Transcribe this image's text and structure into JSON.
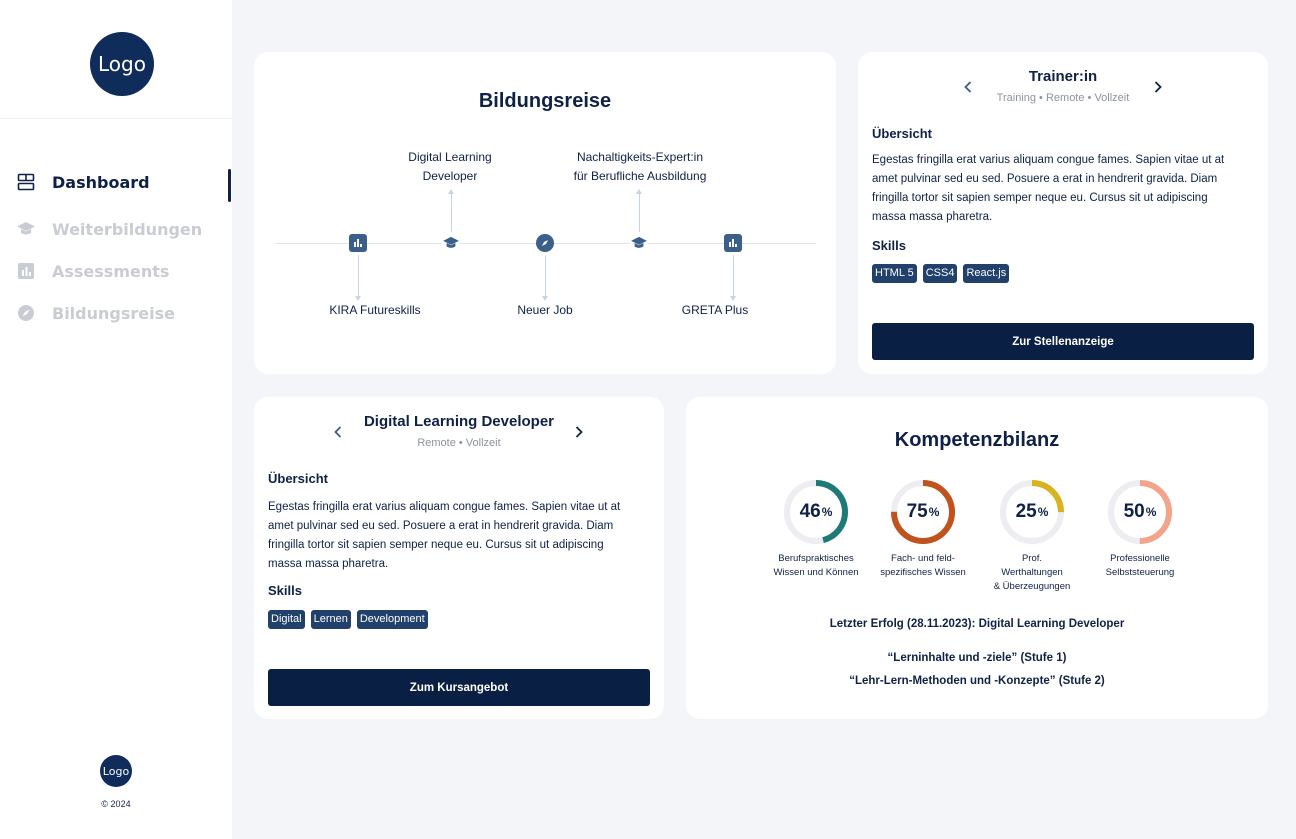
{
  "sidebar": {
    "logo": "Logo",
    "nav": [
      {
        "label": "Dashboard",
        "icon": "dashboard-icon",
        "active": true
      },
      {
        "label": "Weiterbildungen",
        "icon": "graduation-cap-icon",
        "active": false
      },
      {
        "label": "Assessments",
        "icon": "bar-chart-icon",
        "active": false
      },
      {
        "label": "Bildungsreise",
        "icon": "compass-icon",
        "active": false
      }
    ],
    "footer_logo": "Logo",
    "copyright": "© 2024"
  },
  "journey": {
    "title": "Bildungsreise",
    "above": [
      {
        "line1": "Digital Learning",
        "line2": "Developer"
      },
      {
        "line1": "Nachaltigkeits-Expert:in",
        "line2": "für Berufliche Ausbildung"
      }
    ],
    "below": [
      "KIRA Futureskills",
      "Neuer Job",
      "GRETA Plus"
    ],
    "nodes": [
      "bar-chart-icon",
      "graduation-cap-icon",
      "compass-icon",
      "graduation-cap-icon",
      "bar-chart-icon"
    ]
  },
  "job": {
    "title": "Trainer:in",
    "subtitle": "Training • Remote • Vollzeit",
    "overview_heading": "Übersicht",
    "overview_text": "Egestas fringilla erat varius aliquam congue fames. Sapien vitae ut at amet pulvinar sed eu sed. Posuere a erat in hendrerit gravida. Diam fringilla tortor sit sapien semper neque eu. Cursus sit ut adipiscing massa massa pharetra.",
    "skills_heading": "Skills",
    "skills": [
      "HTML 5",
      "CSS4",
      "React.js"
    ],
    "cta": "Zur Stellenanzeige"
  },
  "course": {
    "title": "Digital Learning Developer",
    "subtitle": "Remote • Vollzeit",
    "overview_heading": "Übersicht",
    "overview_text": "Egestas fringilla erat varius aliquam congue fames. Sapien vitae ut at amet pulvinar sed eu sed. Posuere a erat in hendrerit gravida. Diam fringilla tortor sit sapien semper neque eu. Cursus sit ut adipiscing massa massa pharetra.",
    "skills_heading": "Skills",
    "skills": [
      "Digital",
      "Lernen",
      "Development"
    ],
    "cta": "Zum Kursangebot"
  },
  "kompetenz": {
    "title": "Kompetenzbilanz",
    "items": [
      {
        "value": "46",
        "unit": "%",
        "fraction": 0.46,
        "color": "#1f7a75",
        "label1": "Berufspraktisches",
        "label2": "Wissen und Können",
        "label3": ""
      },
      {
        "value": "75",
        "unit": "%",
        "fraction": 0.75,
        "color": "#c0521d",
        "label1": "Fach- und feld-",
        "label2": "spezifisches Wissen",
        "label3": ""
      },
      {
        "value": "25",
        "unit": "%",
        "fraction": 0.25,
        "color": "#d9b21f",
        "label1": "Prof.",
        "label2": "Werthaltungen",
        "label3": "& Überzeugungen"
      },
      {
        "value": "50",
        "unit": "%",
        "fraction": 0.5,
        "color": "#f2a58a",
        "label1": "Professionelle",
        "label2": "Selbststeuerung",
        "label3": ""
      }
    ],
    "last_success": "Letzter Erfolg (28.11.2023): Digital Learning Developer",
    "success_items": [
      "“Lerninhalte und -ziele” (Stufe 1)",
      "“Lehr-Lern-Methoden und -Konzepte” (Stufe 2)"
    ]
  },
  "colors": {
    "primary": "#0f2146",
    "accent": "#3b5e8a",
    "background": "#f3f5f9",
    "tag": "#21406b"
  }
}
